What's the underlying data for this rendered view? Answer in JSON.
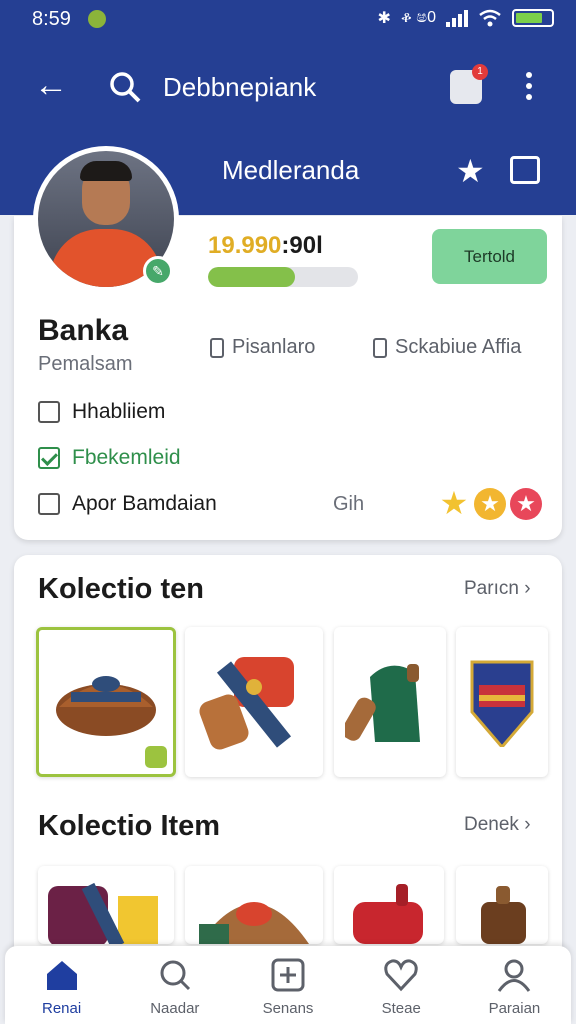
{
  "status_bar": {
    "time": "8:59",
    "network": "ቆ ෂ0"
  },
  "topbar": {
    "search_value": "Debbnepiank",
    "cart_badge": "1"
  },
  "profile": {
    "header_name": "Medleranda",
    "points_gold": "19.990",
    "points_rest": ":90l",
    "progress": 0.58,
    "follow_label": "Tertold",
    "name": "Banka",
    "role": "Pemalsam",
    "tag1": "Pisanlaro",
    "tag2": "Sckabiue Affia",
    "checks": [
      {
        "label": "Hhabliiem",
        "checked": false
      },
      {
        "label": "Fbekemleid",
        "checked": true
      },
      {
        "label": "Apor Bamdaian",
        "checked": false
      }
    ],
    "gih": "Gih"
  },
  "collection1": {
    "title": "Kolectio ten",
    "more": "Parıcn"
  },
  "collection2": {
    "title": "Kolectio Item",
    "more": "Denek"
  },
  "nav": [
    {
      "label": "Renai",
      "icon": "home-icon"
    },
    {
      "label": "Naadar",
      "icon": "search-icon"
    },
    {
      "label": "Senans",
      "icon": "grid-icon"
    },
    {
      "label": "Steae",
      "icon": "heart-icon"
    },
    {
      "label": "Paraian",
      "icon": "person-icon"
    }
  ]
}
